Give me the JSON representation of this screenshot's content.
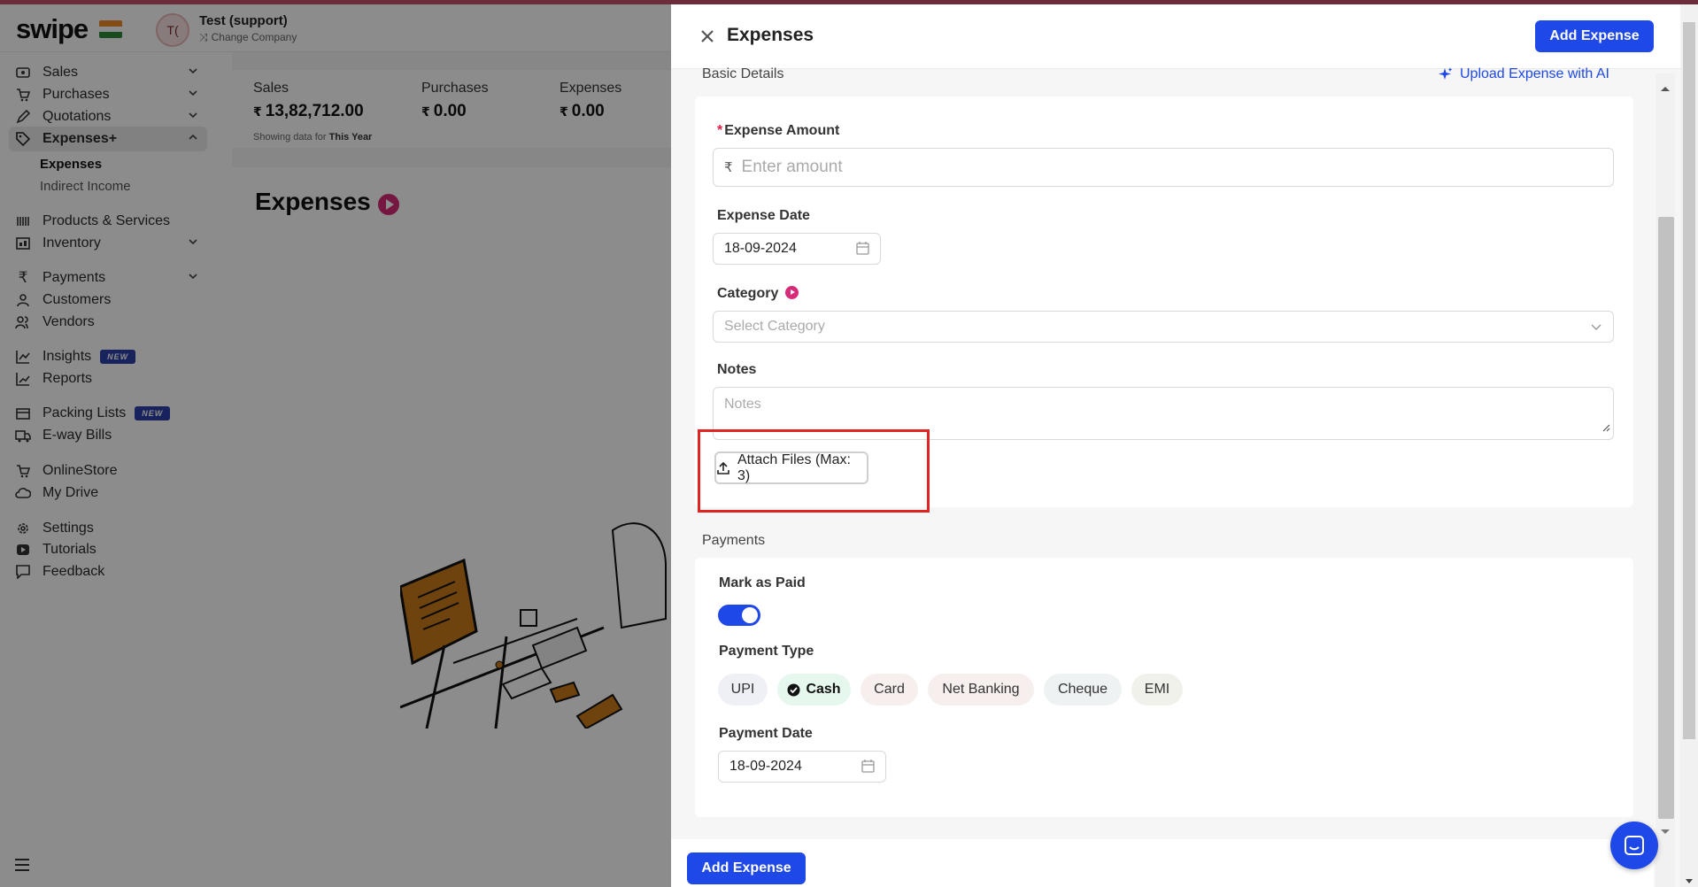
{
  "app": {
    "logo": "swipe",
    "company_name": "Test (support)",
    "company_initials": "T(",
    "change_company": "Change Company"
  },
  "sidebar": {
    "items": [
      {
        "label": "Sales",
        "icon": "sales-icon",
        "expandable": true
      },
      {
        "label": "Purchases",
        "icon": "cart-icon",
        "expandable": true
      },
      {
        "label": "Quotations",
        "icon": "pen-icon",
        "expandable": true
      },
      {
        "label": "Expenses+",
        "icon": "tag-icon",
        "expandable": true,
        "active": true
      },
      {
        "label": "Products & Services",
        "icon": "barcode-icon"
      },
      {
        "label": "Inventory",
        "icon": "inventory-icon",
        "expandable": true
      },
      {
        "label": "Payments",
        "icon": "rupee-icon",
        "expandable": true
      },
      {
        "label": "Customers",
        "icon": "user-icon"
      },
      {
        "label": "Vendors",
        "icon": "users-icon"
      },
      {
        "label": "Insights",
        "icon": "chart-icon",
        "badge": "NEW"
      },
      {
        "label": "Reports",
        "icon": "report-icon"
      },
      {
        "label": "Packing Lists",
        "icon": "box-icon",
        "badge": "NEW"
      },
      {
        "label": "E-way Bills",
        "icon": "truck-icon"
      },
      {
        "label": "OnlineStore",
        "icon": "store-icon"
      },
      {
        "label": "My Drive",
        "icon": "cloud-icon"
      },
      {
        "label": "Settings",
        "icon": "gear-icon"
      },
      {
        "label": "Tutorials",
        "icon": "video-icon"
      },
      {
        "label": "Feedback",
        "icon": "feedback-icon"
      }
    ],
    "sub_items": [
      {
        "label": "Expenses",
        "active": true
      },
      {
        "label": "Indirect Income"
      }
    ]
  },
  "stats": [
    {
      "label": "Sales",
      "value": "13,82,712.00",
      "currency": "₹"
    },
    {
      "label": "Purchases",
      "value": "0.00",
      "currency": "₹"
    },
    {
      "label": "Expenses",
      "value": "0.00",
      "currency": "₹"
    }
  ],
  "stats_note": {
    "prefix": "Showing data for",
    "period": "This Year"
  },
  "page": {
    "title": "Expenses"
  },
  "drawer": {
    "title": "Expenses",
    "add_button": "Add Expense",
    "basic_details": "Basic Details",
    "upload_ai": "Upload Expense with AI",
    "expense_amount": {
      "label": "Expense Amount",
      "required": true,
      "currency": "₹",
      "placeholder": "Enter amount"
    },
    "expense_date": {
      "label": "Expense Date",
      "value": "18-09-2024"
    },
    "category": {
      "label": "Category",
      "placeholder": "Select Category"
    },
    "notes": {
      "label": "Notes",
      "placeholder": "Notes"
    },
    "attach": "Attach Files (Max: 3)",
    "payments_label": "Payments",
    "mark_as_paid": {
      "label": "Mark as Paid",
      "on": true
    },
    "payment_type": {
      "label": "Payment Type",
      "options": [
        {
          "label": "UPI",
          "bg": "#eef0f6"
        },
        {
          "label": "Cash",
          "bg": "#e6f7ee",
          "selected": true
        },
        {
          "label": "Card",
          "bg": "#f7eeee"
        },
        {
          "label": "Net Banking",
          "bg": "#f7eeee"
        },
        {
          "label": "Cheque",
          "bg": "#eef2f2"
        },
        {
          "label": "EMI",
          "bg": "#f1f1ec"
        }
      ]
    },
    "payment_date": {
      "label": "Payment Date",
      "value": "18-09-2024"
    },
    "footer_button": "Add Expense"
  },
  "colors": {
    "primary": "#1f48e8",
    "accent_pink": "#d72a78",
    "highlight": "#e02424"
  }
}
